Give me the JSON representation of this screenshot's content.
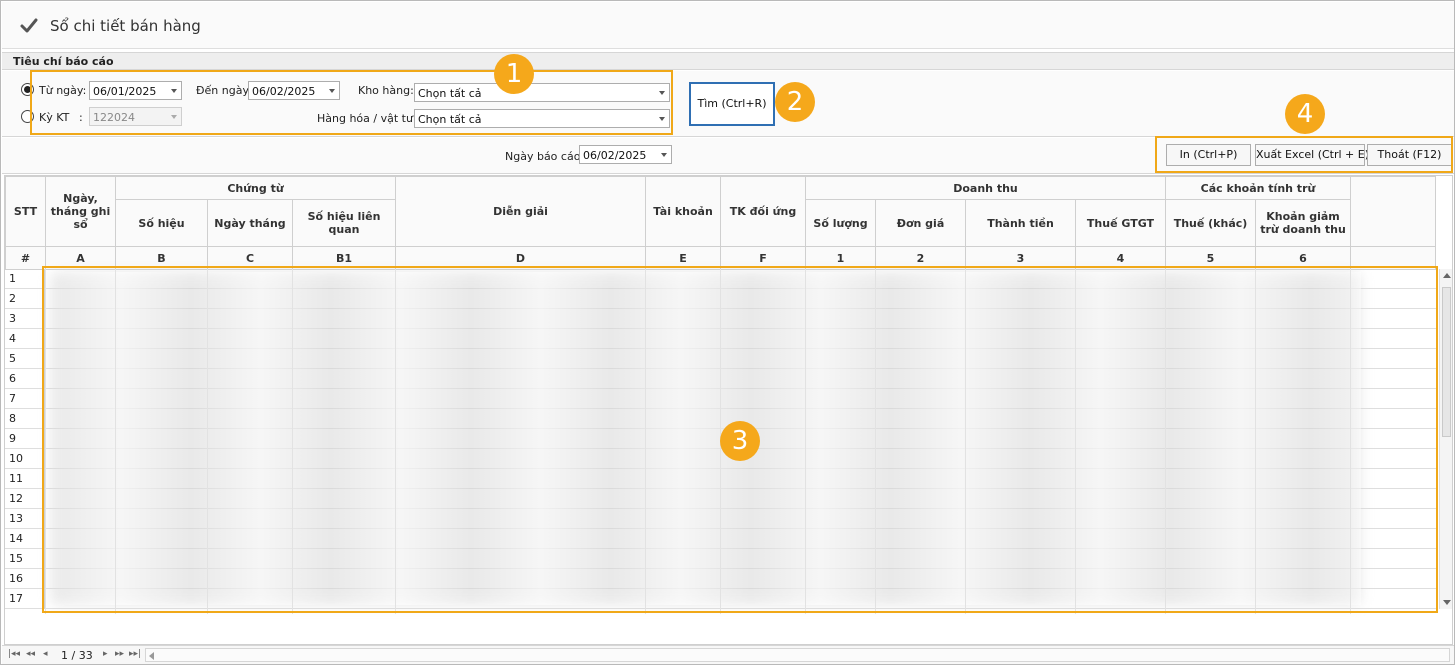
{
  "window": {
    "title": "Sổ chi tiết bán hàng"
  },
  "criteria": {
    "section_title": "Tiêu chí báo cáo",
    "from_date_label": "Từ ngày:",
    "from_date_value": "06/01/2025",
    "to_date_label": "Đến ngày:",
    "to_date_value": "06/02/2025",
    "period_label": "Kỳ KT",
    "period_colon": ":",
    "period_value": "122024",
    "warehouse_label": "Kho hàng:",
    "warehouse_value": "Chọn tất cả",
    "goods_label": "Hàng hóa / vật tư:",
    "goods_value": "Chọn tất cả",
    "search_button": "Tìm  (Ctrl+R)"
  },
  "report_date": {
    "label": "Ngày báo cáo:",
    "value": "06/02/2025"
  },
  "actions": {
    "print": "In  (Ctrl+P)",
    "export_excel": "Xuất Excel  (Ctrl + E)",
    "exit": "Thoát  (F12)"
  },
  "callouts": [
    "1",
    "2",
    "3",
    "4"
  ],
  "table": {
    "headers": {
      "stt": "STT",
      "date": "Ngày, tháng ghi sổ",
      "voucher_group": "Chứng từ",
      "voucher_no": "Số hiệu",
      "voucher_date": "Ngày tháng",
      "related_no": "Số hiệu liên quan",
      "description": "Diễn giải",
      "account": "Tài khoản",
      "contra_account": "TK đối ứng",
      "revenue_group": "Doanh thu",
      "quantity": "Số lượng",
      "unit_price": "Đơn giá",
      "amount": "Thành tiền",
      "vat": "Thuế GTGT",
      "deductions_group": "Các khoản tính trừ",
      "other_tax": "Thuế (khác)",
      "revenue_deduction": "Khoản giảm trừ doanh thu"
    },
    "col_refs": [
      "#",
      "A",
      "B",
      "C",
      "B1",
      "D",
      "E",
      "F",
      "1",
      "2",
      "3",
      "4",
      "5",
      "6"
    ],
    "row_numbers": [
      "1",
      "2",
      "3",
      "4",
      "5",
      "6",
      "7",
      "8",
      "9",
      "10",
      "11",
      "12",
      "13",
      "14",
      "15",
      "16",
      "17"
    ]
  },
  "pager": {
    "page": "1 / 33"
  },
  "colors": {
    "accent": "#f5a81b",
    "focus": "#2f6fb3"
  },
  "icons": [
    "check-icon",
    "first-page-icon",
    "prev-block-icon",
    "prev-page-icon",
    "next-page-icon",
    "next-block-icon",
    "last-page-icon"
  ]
}
